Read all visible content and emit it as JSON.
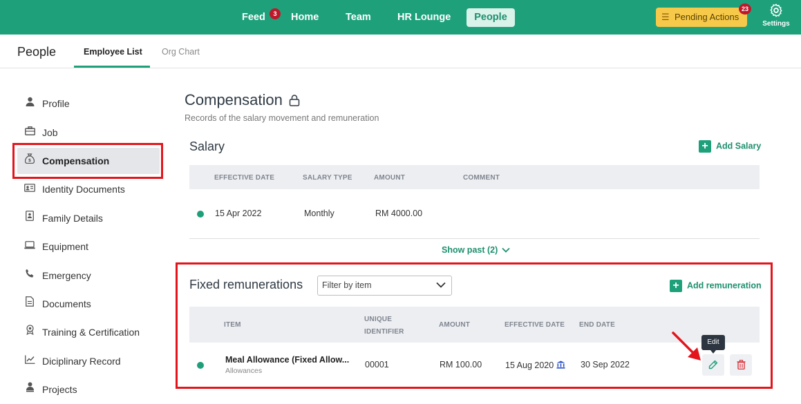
{
  "nav": {
    "items": [
      {
        "label": "Feed",
        "badge": "3"
      },
      {
        "label": "Home"
      },
      {
        "label": "Team"
      },
      {
        "label": "HR Lounge"
      },
      {
        "label": "People",
        "active": true
      }
    ],
    "pending_label": "Pending Actions",
    "pending_badge": "23",
    "settings_label": "Settings",
    "brand_color": "#1ea17b"
  },
  "subheader": {
    "title": "People",
    "tabs": [
      {
        "label": "Employee List",
        "active": true
      },
      {
        "label": "Org Chart",
        "active": false
      }
    ]
  },
  "sidebar": {
    "items": [
      {
        "label": "Profile",
        "icon": "user-icon"
      },
      {
        "label": "Job",
        "icon": "briefcase-icon"
      },
      {
        "label": "Compensation",
        "icon": "money-bag-icon",
        "active": true
      },
      {
        "label": "Identity Documents",
        "icon": "id-card-icon"
      },
      {
        "label": "Family Details",
        "icon": "family-icon"
      },
      {
        "label": "Equipment",
        "icon": "laptop-icon"
      },
      {
        "label": "Emergency",
        "icon": "phone-icon"
      },
      {
        "label": "Documents",
        "icon": "document-icon"
      },
      {
        "label": "Training & Certification",
        "icon": "award-icon"
      },
      {
        "label": "Diciplinary Record",
        "icon": "chart-icon"
      },
      {
        "label": "Projects",
        "icon": "person-badge-icon"
      }
    ]
  },
  "main": {
    "title": "Compensation",
    "subtitle": "Records of the salary movement and remuneration",
    "salary": {
      "title": "Salary",
      "add_label": "Add Salary",
      "columns": [
        "EFFECTIVE DATE",
        "SALARY TYPE",
        "AMOUNT",
        "COMMENT"
      ],
      "rows": [
        {
          "effective_date": "15 Apr 2022",
          "salary_type": "Monthly",
          "amount": "RM 4000.00",
          "comment": ""
        }
      ],
      "show_past": "Show past (2)"
    },
    "fixed": {
      "title": "Fixed remunerations",
      "filter_placeholder": "Filter by item",
      "add_label": "Add remuneration",
      "columns": {
        "item": "ITEM",
        "unique_1": "UNIQUE",
        "unique_2": "IDENTIFIER",
        "amount": "AMOUNT",
        "effective": "EFFECTIVE DATE",
        "end": "END DATE"
      },
      "rows": [
        {
          "item": "Meal Allowance (Fixed Allow...",
          "category": "Allowances",
          "unique_identifier": "00001",
          "amount": "RM 100.00",
          "effective_date": "15 Aug 2020",
          "end_date": "30 Sep 2022"
        }
      ],
      "edit_tooltip": "Edit"
    }
  }
}
